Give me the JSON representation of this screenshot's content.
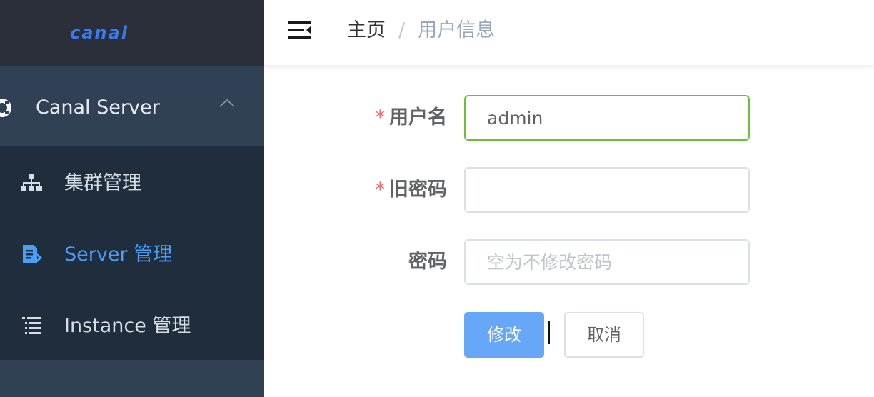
{
  "sidebar": {
    "logo_text": "canal",
    "submenu": {
      "label": "Canal Server",
      "icon": "ring-icon",
      "expanded": true
    },
    "items": [
      {
        "label": "集群管理",
        "icon": "sitemap-icon",
        "active": false
      },
      {
        "label": "Server 管理",
        "icon": "server-doc-icon",
        "active": true
      },
      {
        "label": "Instance 管理",
        "icon": "list-icon",
        "active": false
      }
    ]
  },
  "header": {
    "breadcrumb": {
      "home": "主页",
      "separator": "/",
      "current": "用户信息"
    }
  },
  "form": {
    "username": {
      "label": "用户名",
      "required_mark": "*",
      "value": "admin"
    },
    "old_password": {
      "label": "旧密码",
      "required_mark": "*",
      "value": ""
    },
    "password": {
      "label": "密码",
      "placeholder": "空为不修改密码",
      "value": ""
    },
    "submit_label": "修改",
    "cancel_label": "取消"
  },
  "colors": {
    "sidebar_bg": "#304156",
    "sidebar_submenu_bg": "#1f2d3d",
    "logo_bar_bg": "#2b2f3a",
    "active_menu": "#4a9ff5",
    "primary_button": "#66a8f7",
    "focused_border": "#67c23a",
    "required_mark": "#f56c6c"
  }
}
